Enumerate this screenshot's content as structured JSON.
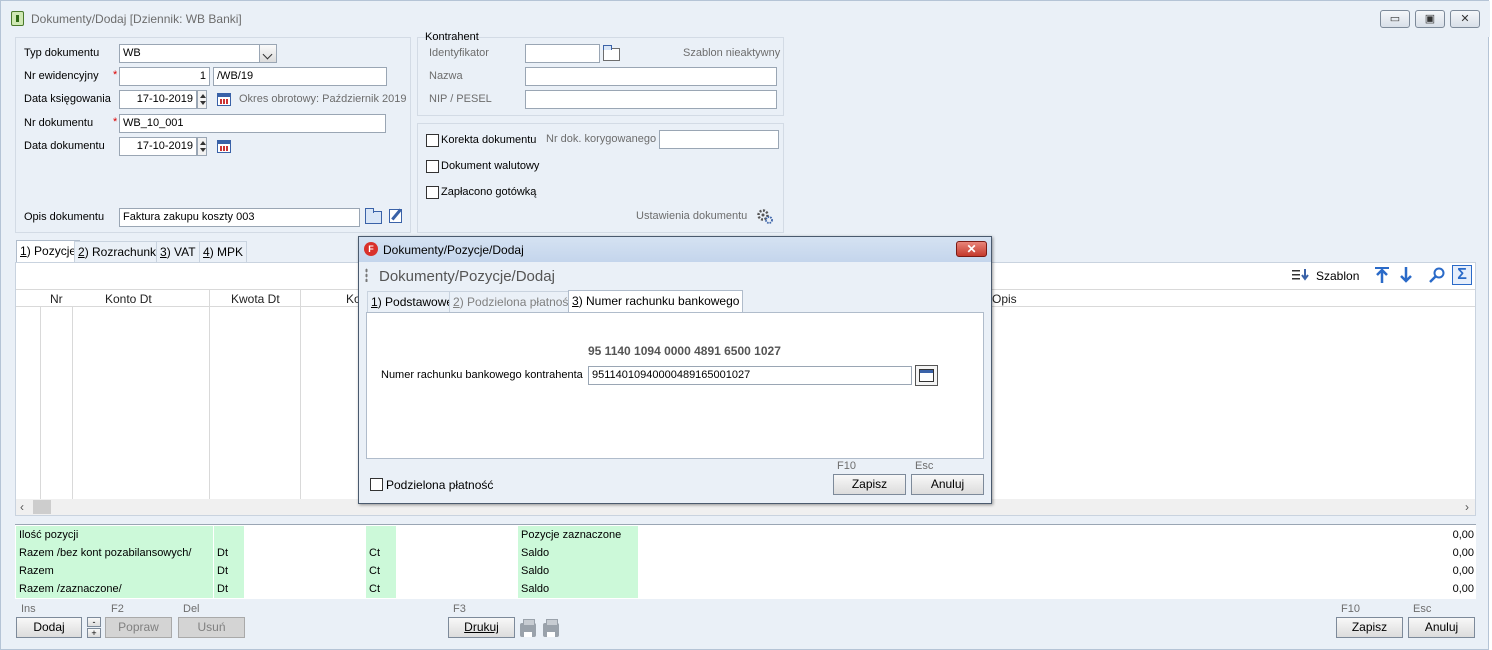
{
  "window": {
    "title": "Dokumenty/Dodaj [Dziennik: WB  Banki]",
    "minimize": "▭",
    "restore": "▣",
    "close": "✕"
  },
  "form": {
    "typ_label": "Typ dokumentu",
    "typ_value": "WB",
    "nr_ewid_label": "Nr ewidencyjny",
    "nr_ewid_num": "1",
    "nr_ewid_suffix": "/WB/19",
    "data_ksieg_label": "Data księgowania",
    "data_ksieg_value": "17-10-2019",
    "okres": "Okres obrotowy: Październik 2019",
    "nr_dok_label": "Nr dokumentu",
    "nr_dok_value": "WB_10_001",
    "data_dok_label": "Data dokumentu",
    "data_dok_value": "17-10-2019",
    "opis_label": "Opis dokumentu",
    "opis_value": "Faktura zakupu koszty 003",
    "required_mark": "*"
  },
  "kontrahent": {
    "group": "Kontrahent",
    "identyfikator": "Identyfikator",
    "szablon": "Szablon nieaktywny",
    "nazwa": "Nazwa",
    "nip": "NIP / PESEL"
  },
  "options": {
    "korekta": "Korekta dokumentu",
    "nr_kor": "Nr dok. korygowanego",
    "walutowy": "Dokument walutowy",
    "gotowka": "Zapłacono gotówką",
    "ustawienia": "Ustawienia dokumentu"
  },
  "tabs": [
    {
      "key": "1",
      "rest": ") Pozycje"
    },
    {
      "key": "2",
      "rest": ") Rozrachunki"
    },
    {
      "key": "3",
      "rest": ") VAT"
    },
    {
      "key": "4",
      "rest": ") MPK"
    }
  ],
  "toolbar": {
    "szablon": "Szablon"
  },
  "grid": {
    "headers": [
      "Nr",
      "Konto Dt",
      "Kwota Dt",
      "Ko",
      "Opis"
    ]
  },
  "summary": {
    "rows": [
      {
        "label": "Ilość pozycji",
        "dt": "",
        "ct": "",
        "right": "Pozycje zaznaczone",
        "value": "0,00"
      },
      {
        "label": "Razem /bez kont pozabilansowych/",
        "dt": "Dt",
        "ct": "Ct",
        "right": "Saldo",
        "value": "0,00"
      },
      {
        "label": "Razem",
        "dt": "Dt",
        "ct": "Ct",
        "right": "Saldo",
        "value": "0,00"
      },
      {
        "label": "Razem /zaznaczone/",
        "dt": "Dt",
        "ct": "Ct",
        "right": "Saldo",
        "value": "0,00"
      }
    ]
  },
  "bottom": {
    "ins": "Ins",
    "dodaj": "Dodaj",
    "f2": "F2",
    "popraw": "Popraw",
    "del": "Del",
    "usun": "Usuń",
    "f3": "F3",
    "drukuj": "Drukuj",
    "f10": "F10",
    "zapisz": "Zapisz",
    "esc": "Esc",
    "anuluj": "Anuluj",
    "plus": "+",
    "minus": "-"
  },
  "dialog": {
    "title": "Dokumenty/Pozycje/Dodaj",
    "heading": "Dokumenty/Pozycje/Dodaj",
    "tabs": [
      {
        "key": "1",
        "rest": ") Podstawowe"
      },
      {
        "key": "2",
        "rest": ") Podzielona płatność"
      },
      {
        "key": "3",
        "rest": ") Numer rachunku bankowego"
      }
    ],
    "iban_formatted": "95 1140 1094 0000 4891 6500 1027",
    "account_label": "Numer rachunku bankowego kontrahenta",
    "account_value": "95114010940000489165001027",
    "podzielona": "Podzielona płatność",
    "f10": "F10",
    "zapisz": "Zapisz",
    "esc": "Esc",
    "anuluj": "Anuluj",
    "close": "✕",
    "app_letter": "F"
  }
}
